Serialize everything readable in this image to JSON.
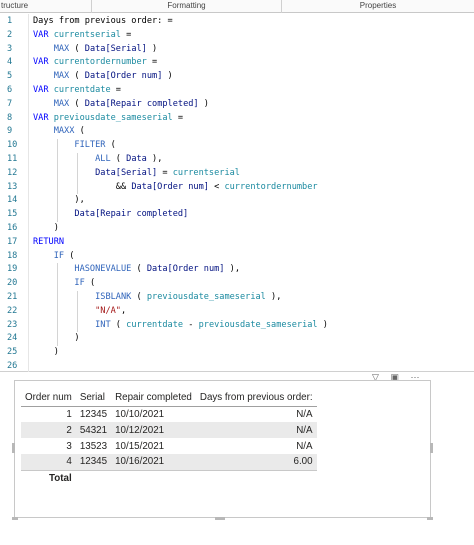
{
  "tabs": [
    "tructure",
    "Formatting",
    "Properties"
  ],
  "code_lines": [
    [
      [
        "txt",
        "Days from previous order: ="
      ]
    ],
    [
      [
        "kw",
        "VAR "
      ],
      [
        "var",
        "currentserial"
      ],
      [
        "txt",
        " ="
      ]
    ],
    [
      [
        "txt",
        "    "
      ],
      [
        "fn",
        "MAX"
      ],
      [
        "txt",
        " ( "
      ],
      [
        "col",
        "Data[Serial]"
      ],
      [
        "txt",
        " )"
      ]
    ],
    [
      [
        "kw",
        "VAR "
      ],
      [
        "var",
        "currentordernumber"
      ],
      [
        "txt",
        " ="
      ]
    ],
    [
      [
        "txt",
        "    "
      ],
      [
        "fn",
        "MAX"
      ],
      [
        "txt",
        " ( "
      ],
      [
        "col",
        "Data[Order num]"
      ],
      [
        "txt",
        " )"
      ]
    ],
    [
      [
        "kw",
        "VAR "
      ],
      [
        "var",
        "currentdate"
      ],
      [
        "txt",
        " ="
      ]
    ],
    [
      [
        "txt",
        "    "
      ],
      [
        "fn",
        "MAX"
      ],
      [
        "txt",
        " ( "
      ],
      [
        "col",
        "Data[Repair completed]"
      ],
      [
        "txt",
        " )"
      ]
    ],
    [
      [
        "kw",
        "VAR "
      ],
      [
        "var",
        "previousdate_sameserial"
      ],
      [
        "txt",
        " ="
      ]
    ],
    [
      [
        "txt",
        "    "
      ],
      [
        "fn",
        "MAXX"
      ],
      [
        "txt",
        " ("
      ]
    ],
    [
      [
        "txt",
        "        "
      ],
      [
        "fn",
        "FILTER"
      ],
      [
        "txt",
        " ("
      ]
    ],
    [
      [
        "txt",
        "            "
      ],
      [
        "fn",
        "ALL"
      ],
      [
        "txt",
        " ( "
      ],
      [
        "col",
        "Data"
      ],
      [
        "txt",
        " ),"
      ]
    ],
    [
      [
        "txt",
        "            "
      ],
      [
        "col",
        "Data[Serial]"
      ],
      [
        "txt",
        " = "
      ],
      [
        "var",
        "currentserial"
      ]
    ],
    [
      [
        "txt",
        "                && "
      ],
      [
        "col",
        "Data[Order num]"
      ],
      [
        "txt",
        " < "
      ],
      [
        "var",
        "currentordernumber"
      ]
    ],
    [
      [
        "txt",
        "        ),"
      ]
    ],
    [
      [
        "txt",
        "        "
      ],
      [
        "col",
        "Data[Repair completed]"
      ]
    ],
    [
      [
        "txt",
        "    )"
      ]
    ],
    [
      [
        "kw",
        "RETURN"
      ]
    ],
    [
      [
        "txt",
        "    "
      ],
      [
        "fn",
        "IF"
      ],
      [
        "txt",
        " ("
      ]
    ],
    [
      [
        "txt",
        "        "
      ],
      [
        "fn",
        "HASONEVALUE"
      ],
      [
        "txt",
        " ( "
      ],
      [
        "col",
        "Data[Order num]"
      ],
      [
        "txt",
        " ),"
      ]
    ],
    [
      [
        "txt",
        "        "
      ],
      [
        "fn",
        "IF"
      ],
      [
        "txt",
        " ("
      ]
    ],
    [
      [
        "txt",
        "            "
      ],
      [
        "fn",
        "ISBLANK"
      ],
      [
        "txt",
        " ( "
      ],
      [
        "var",
        "previousdate_sameserial"
      ],
      [
        "txt",
        " ),"
      ]
    ],
    [
      [
        "txt",
        "            "
      ],
      [
        "str",
        "\"N/A\""
      ],
      [
        "txt",
        ","
      ]
    ],
    [
      [
        "txt",
        "            "
      ],
      [
        "fn",
        "INT"
      ],
      [
        "txt",
        " ( "
      ],
      [
        "var",
        "currentdate"
      ],
      [
        "txt",
        " - "
      ],
      [
        "var",
        "previousdate_sameserial"
      ],
      [
        "txt",
        " )"
      ]
    ],
    [
      [
        "txt",
        "        )"
      ]
    ],
    [
      [
        "txt",
        "    )"
      ]
    ],
    [
      [
        "txt",
        ""
      ]
    ]
  ],
  "table": {
    "headers": [
      "Order num",
      "Serial",
      "Repair completed",
      "Days from previous order:"
    ],
    "rows": [
      [
        "1",
        "12345",
        "10/10/2021",
        "N/A"
      ],
      [
        "2",
        "54321",
        "10/12/2021",
        "N/A"
      ],
      [
        "3",
        "13523",
        "10/15/2021",
        "N/A"
      ],
      [
        "4",
        "12345",
        "10/16/2021",
        "6.00"
      ]
    ],
    "total_label": "Total"
  },
  "visual_icons": [
    "filter-icon",
    "focus-mode-icon",
    "more-options-icon"
  ]
}
